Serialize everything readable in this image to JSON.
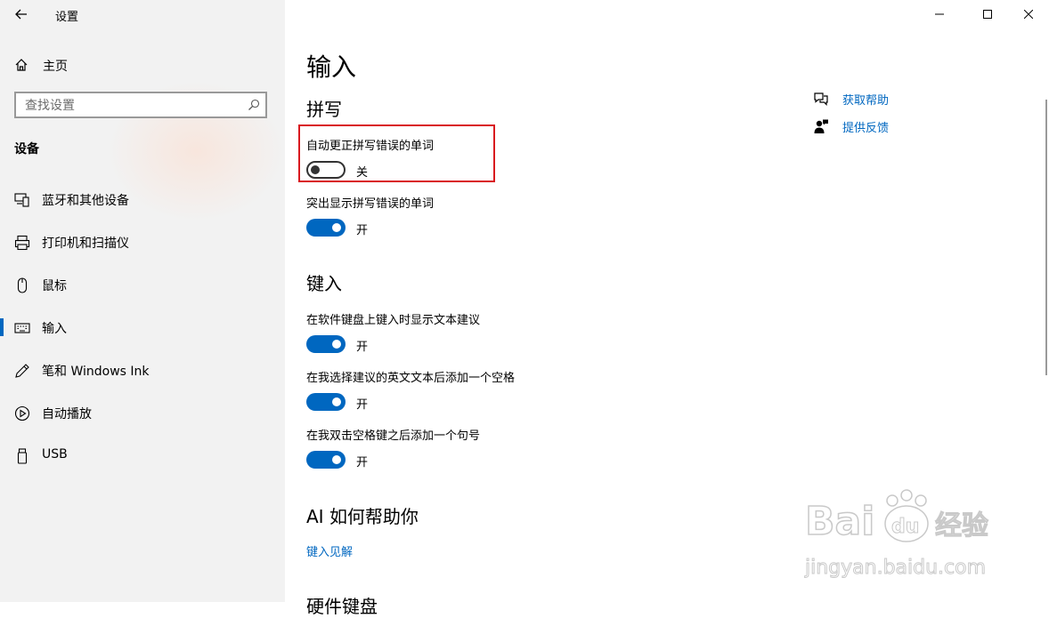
{
  "window": {
    "title": "设置",
    "controls": [
      "minimize-icon",
      "maximize-icon",
      "close-icon"
    ]
  },
  "sidebar": {
    "home_label": "主页",
    "search_placeholder": "查找设置",
    "section_title": "设备",
    "items": [
      {
        "label": "蓝牙和其他设备",
        "icon": "bluetooth-devices-icon",
        "active": false
      },
      {
        "label": "打印机和扫描仪",
        "icon": "printer-icon",
        "active": false
      },
      {
        "label": "鼠标",
        "icon": "mouse-icon",
        "active": false
      },
      {
        "label": "输入",
        "icon": "keyboard-icon",
        "active": true
      },
      {
        "label": "笔和 Windows Ink",
        "icon": "pen-icon",
        "active": false
      },
      {
        "label": "自动播放",
        "icon": "autoplay-icon",
        "active": false
      },
      {
        "label": "USB",
        "icon": "usb-icon",
        "active": false
      }
    ]
  },
  "main": {
    "page_title": "输入",
    "spelling": {
      "title": "拼写",
      "autocorrect": {
        "label": "自动更正拼写错误的单词",
        "state": "关",
        "on": false
      },
      "highlight": {
        "label": "突出显示拼写错误的单词",
        "state": "开",
        "on": true
      }
    },
    "typing": {
      "title": "键入",
      "suggestions": {
        "label": "在软件键盘上键入时显示文本建议",
        "state": "开",
        "on": true
      },
      "add_space": {
        "label": "在我选择建议的英文文本后添加一个空格",
        "state": "开",
        "on": true
      },
      "add_period": {
        "label": "在我双击空格键之后添加一个句号",
        "state": "开",
        "on": true
      }
    },
    "ai": {
      "title": "AI 如何帮助你",
      "link": "键入见解"
    },
    "next_section_partial": "硬件键盘"
  },
  "help": {
    "get_help": "获取帮助",
    "feedback": "提供反馈"
  },
  "watermark": {
    "brand": "Baidu经验",
    "url": "jingyan.baidu.com"
  },
  "colors": {
    "accent": "#0067c0",
    "highlight_box": "#d9181f",
    "sidebar_bg": "#f2f2f2"
  }
}
